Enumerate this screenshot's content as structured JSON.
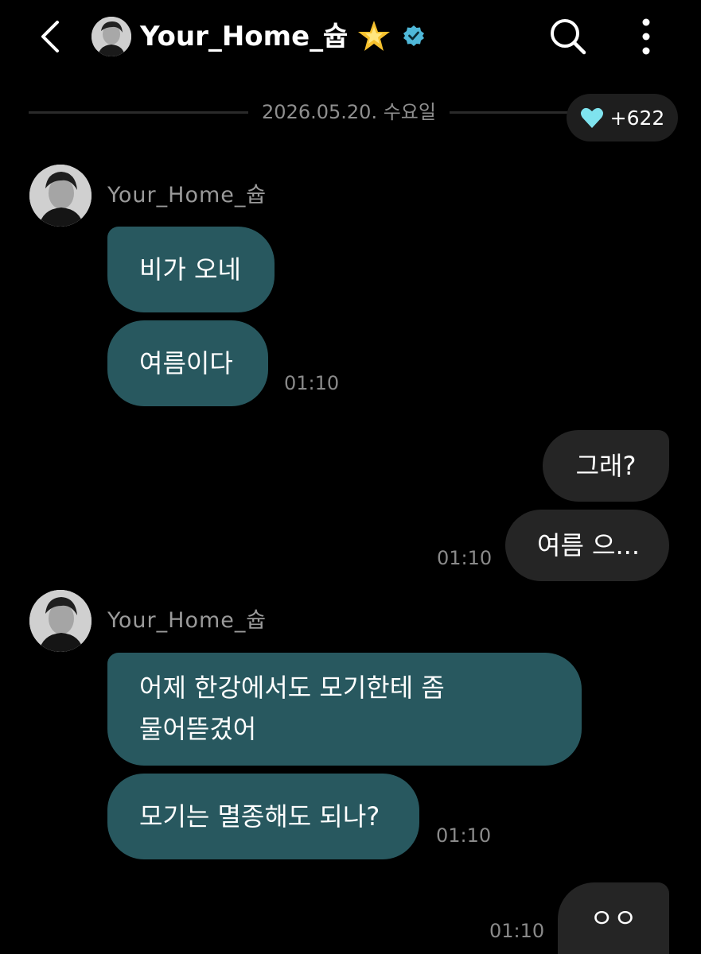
{
  "header": {
    "back_icon": "chevron-left-icon",
    "title": "Your_Home_슙",
    "badge_emoji": "star-icon",
    "verified_icon": "verified-check-icon",
    "search_icon": "search-icon",
    "more_icon": "more-vertical-icon"
  },
  "divider": {
    "date": "2026.05.20. 수요일"
  },
  "hearts": {
    "icon": "heart-icon",
    "count": "+622",
    "color": "#7fe3ee"
  },
  "colors": {
    "incoming_bubble": "#28585f",
    "outgoing_bubble": "#252525",
    "background": "#000000"
  },
  "messages": {
    "group1": {
      "sender": "Your_Home_슙",
      "bubbles": [
        "비가 오네",
        "여름이다"
      ],
      "time": "01:10"
    },
    "group2": {
      "bubbles": [
        "그래?",
        "여름 으..."
      ],
      "time": "01:10"
    },
    "group3": {
      "sender": "Your_Home_슙",
      "bubbles": [
        "어제 한강에서도 모기한테 좀",
        "물어뜯겼어",
        "모기는 멸종해도 되나?"
      ],
      "time": "01:10"
    },
    "group4": {
      "bubbles": [
        "ㅇㅇ"
      ],
      "time": "01:10"
    }
  }
}
